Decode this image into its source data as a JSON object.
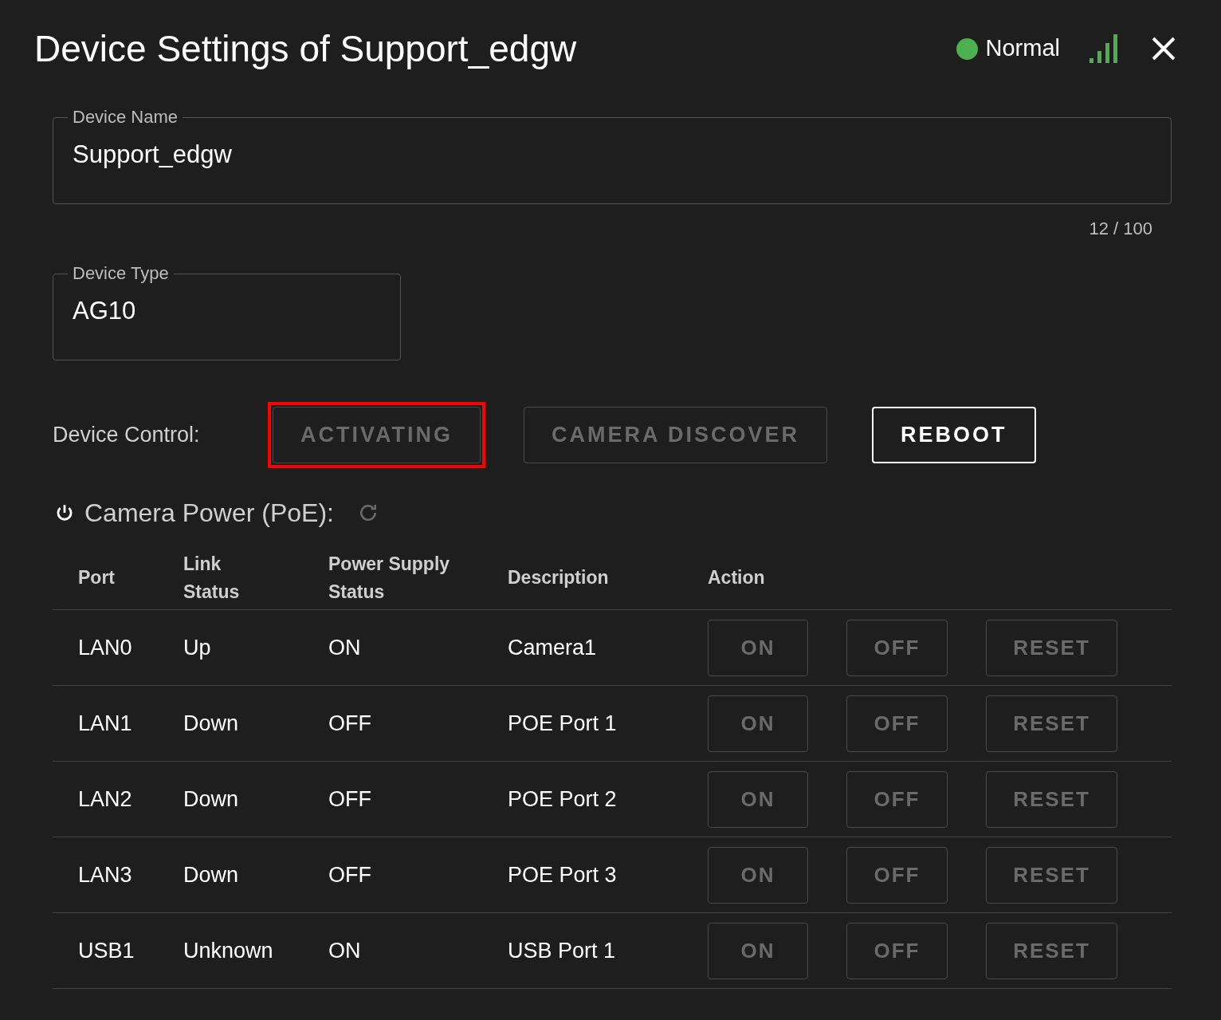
{
  "title": "Device Settings of Support_edgw",
  "status": {
    "label": "Normal",
    "color": "#4caf50"
  },
  "device_name": {
    "label": "Device Name",
    "value": "Support_edgw",
    "counter": "12 / 100"
  },
  "device_type": {
    "label": "Device Type",
    "value": "AG10"
  },
  "device_control": {
    "label": "Device Control:",
    "buttons": [
      {
        "label": "ACTIVATING",
        "disabled": true,
        "highlighted": true
      },
      {
        "label": "CAMERA DISCOVER",
        "disabled": true,
        "highlighted": false
      },
      {
        "label": "REBOOT",
        "disabled": false,
        "highlighted": false
      }
    ]
  },
  "camera_power": {
    "label": "Camera Power (PoE):"
  },
  "table": {
    "columns": [
      "Port",
      "Link Status",
      "Power Supply Status",
      "Description",
      "Action"
    ],
    "rows": [
      {
        "port": "LAN0",
        "link": "Up",
        "power": "ON",
        "description": "Camera1",
        "actions": [
          {
            "label": "ON",
            "disabled": true
          },
          {
            "label": "OFF",
            "disabled": true
          },
          {
            "label": "RESET",
            "disabled": true
          }
        ]
      },
      {
        "port": "LAN1",
        "link": "Down",
        "power": "OFF",
        "description": "POE Port 1",
        "actions": [
          {
            "label": "ON",
            "disabled": true
          },
          {
            "label": "OFF",
            "disabled": true
          },
          {
            "label": "RESET",
            "disabled": true
          }
        ]
      },
      {
        "port": "LAN2",
        "link": "Down",
        "power": "OFF",
        "description": "POE Port 2",
        "actions": [
          {
            "label": "ON",
            "disabled": true
          },
          {
            "label": "OFF",
            "disabled": true
          },
          {
            "label": "RESET",
            "disabled": true
          }
        ]
      },
      {
        "port": "LAN3",
        "link": "Down",
        "power": "OFF",
        "description": "POE Port 3",
        "actions": [
          {
            "label": "ON",
            "disabled": true
          },
          {
            "label": "OFF",
            "disabled": true
          },
          {
            "label": "RESET",
            "disabled": true
          }
        ]
      },
      {
        "port": "USB1",
        "link": "Unknown",
        "power": "ON",
        "description": "USB Port 1",
        "actions": [
          {
            "label": "ON",
            "disabled": true
          },
          {
            "label": "OFF",
            "disabled": true
          },
          {
            "label": "RESET",
            "disabled": true
          }
        ]
      }
    ]
  }
}
